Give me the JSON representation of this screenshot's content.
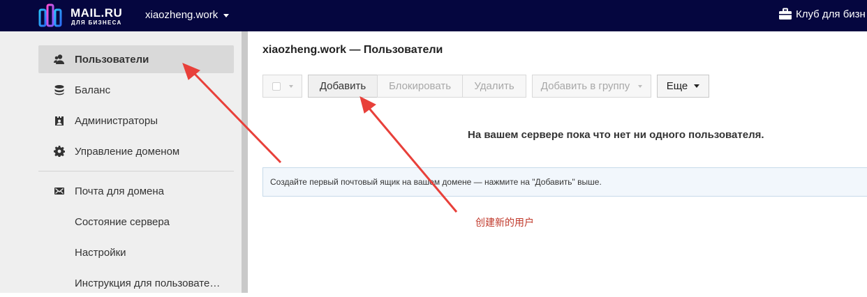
{
  "header": {
    "logo_text": "MAIL.RU",
    "logo_subtext": "ДЛЯ БИЗНЕСА",
    "domain": "xiaozheng.work",
    "club_label": "Клуб для бизн"
  },
  "sidebar": {
    "items": [
      {
        "label": "Пользователи",
        "icon": "users-icon",
        "active": true
      },
      {
        "label": "Баланс",
        "icon": "database-icon"
      },
      {
        "label": "Администраторы",
        "icon": "admins-icon"
      },
      {
        "label": "Управление доменом",
        "icon": "gear-icon"
      },
      {
        "label": "Почта для домена",
        "icon": "mail-icon"
      },
      {
        "label": "Состояние сервера"
      },
      {
        "label": "Настройки"
      },
      {
        "label": "Инструкция для пользовате…"
      }
    ]
  },
  "main": {
    "title": "xiaozheng.work — Пользователи",
    "toolbar": {
      "add": "Добавить",
      "block": "Блокировать",
      "delete": "Удалить",
      "add_to_group": "Добавить в группу",
      "more": "Еще"
    },
    "empty_message": "На вашем сервере пока что нет ни одного пользователя.",
    "hint": "Создайте первый почтовый ящик на вашем домене — нажмите на \"Добавить\" выше."
  },
  "annotation": {
    "text": "创建新的用户",
    "color": "#e8403a"
  },
  "colors": {
    "topbar": "#05063f",
    "sidebar": "#efefef",
    "active_item": "#d9d9d9",
    "hint_bg": "#f2f7fc"
  }
}
